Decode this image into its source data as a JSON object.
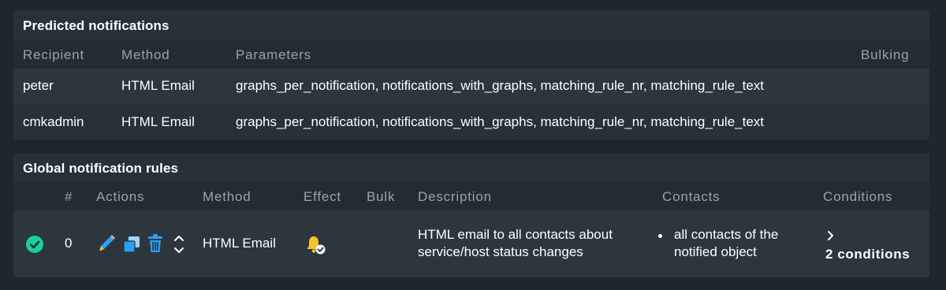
{
  "predicted": {
    "title": "Predicted notifications",
    "headers": {
      "recipient": "Recipient",
      "method": "Method",
      "parameters": "Parameters",
      "bulking": "Bulking"
    },
    "rows": [
      {
        "recipient": "peter",
        "method": "HTML Email",
        "parameters": "graphs_per_notification, notifications_with_graphs, matching_rule_nr, matching_rule_text",
        "bulking": ""
      },
      {
        "recipient": "cmkadmin",
        "method": "HTML Email",
        "parameters": "graphs_per_notification, notifications_with_graphs, matching_rule_nr, matching_rule_text",
        "bulking": ""
      }
    ]
  },
  "global_rules": {
    "title": "Global notification rules",
    "headers": {
      "num": "#",
      "actions": "Actions",
      "method": "Method",
      "effect": "Effect",
      "bulk": "Bulk",
      "description": "Description",
      "contacts": "Contacts",
      "conditions": "Conditions"
    },
    "rows": [
      {
        "num": "0",
        "method": "HTML Email",
        "description_line1": "HTML email to all contacts about",
        "description_line2": "service/host status changes",
        "contacts_line1": "all contacts of the",
        "contacts_line2": "notified object",
        "conditions_label": "2 conditions",
        "status_icon": "check-circle-icon",
        "effect_icon": "bell-check-icon",
        "action_icons": [
          "edit-pencil-icon",
          "clone-icon",
          "delete-trash-icon",
          "move-updown-icon"
        ]
      }
    ]
  },
  "colors": {
    "page_bg": "#1e262e",
    "panel_bg": "#283038",
    "header_text": "#9aa3ab",
    "success_green": "#15d1a0",
    "accent_blue": "#27a1f0",
    "bell_yellow": "#f4c430"
  }
}
